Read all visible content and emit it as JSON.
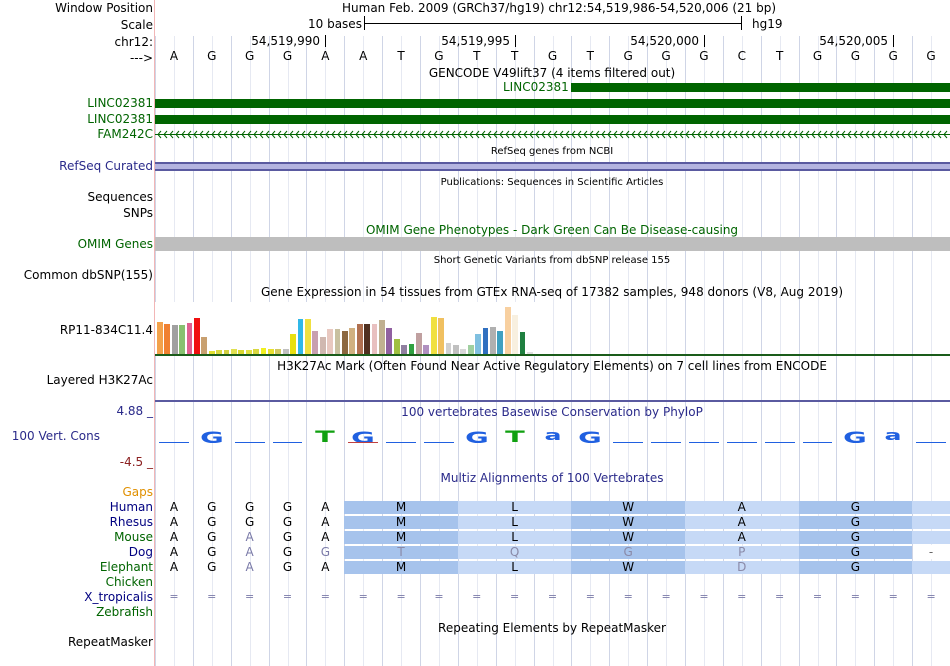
{
  "labels": {
    "window_position": "Window Position",
    "scale": "Scale",
    "chrom": "chr12:",
    "strand": "--->",
    "gene1": "LINC02381",
    "gene2": "LINC02381",
    "gene3": "FAM242C",
    "refseq": "RefSeq Curated",
    "sequences": "Sequences",
    "snps": "SNPs",
    "omim": "OMIM Genes",
    "dbsnp": "Common dbSNP(155)",
    "gtex_gene": "RP11-834C11.4",
    "h3k27ac": "Layered H3K27Ac",
    "cons_max": "4.88 _",
    "cons": "100 Vert. Cons",
    "cons_min": "-4.5 _",
    "gaps": "Gaps",
    "repeatmasker": "RepeatMasker"
  },
  "header": {
    "position": "Human Feb. 2009 (GRCh37/hg19)   chr12:54,519,986-54,520,006 (21 bp)",
    "scale_text": "10 bases",
    "assembly": "hg19",
    "ticks": [
      "54,519,990",
      "54,519,995",
      "54,520,000",
      "54,520,005"
    ]
  },
  "bases": [
    "A",
    "G",
    "G",
    "G",
    "A",
    "A",
    "T",
    "G",
    "T",
    "T",
    "G",
    "T",
    "G",
    "G",
    "G",
    "C",
    "T",
    "G",
    "G",
    "G",
    "G"
  ],
  "centers": {
    "gencode": "GENCODE V49lift37 (4 items filtered out)",
    "gencode_item": "LINC02381",
    "refseq": "RefSeq genes from NCBI",
    "publications": "Publications: Sequences in Scientific Articles",
    "omim": "OMIM Gene Phenotypes - Dark Green Can Be Disease-causing",
    "dbsnp": "Short Genetic Variants from dbSNP release 155",
    "gtex": "Gene Expression in 54 tissues from GTEx RNA-seq of 17382 samples, 948 donors (V8, Aug 2019)",
    "h3k27ac": "H3K27Ac Mark (Often Found Near Active Regulatory Elements) on 7 cell lines from ENCODE",
    "phylop": "100 vertebrates Basewise Conservation by PhyloP",
    "multiz": "Multiz Alignments of 100 Vertebrates",
    "repeatmasker": "Repeating Elements by RepeatMasker"
  },
  "gtex_values": [
    0.62,
    0.58,
    0.55,
    0.56,
    0.6,
    0.7,
    0.33,
    0.06,
    0.08,
    0.08,
    0.1,
    0.08,
    0.08,
    0.1,
    0.12,
    0.1,
    0.1,
    0.1,
    0.38,
    0.68,
    0.68,
    0.45,
    0.33,
    0.48,
    0.48,
    0.45,
    0.5,
    0.58,
    0.58,
    0.58,
    0.65,
    0.5,
    0.28,
    0.18,
    0.2,
    0.4,
    0.18,
    0.72,
    0.7,
    0.22,
    0.18,
    0.1,
    0.18,
    0.38,
    0.5,
    0.52,
    0.45,
    0.9,
    0.75,
    0.42,
    0.03
  ],
  "gtex_colors": [
    "#f3a14a",
    "#f08030",
    "#a0a0a0",
    "#88c070",
    "#e06090",
    "#f01010",
    "#c8a070",
    "#e0e030",
    "#d8d840",
    "#d0d040",
    "#e0e050",
    "#d8d830",
    "#e0e040",
    "#d8d840",
    "#f0f020",
    "#e8e030",
    "#d0c860",
    "#c0c0c0",
    "#e8e010",
    "#30b8e8",
    "#f0e040",
    "#c8a0b0",
    "#d0b8b0",
    "#e8c8c0",
    "#c8c0a0",
    "#8c6840",
    "#d0b080",
    "#b07050",
    "#503020",
    "#e8c0c0",
    "#c0b090",
    "#9060a0",
    "#a0c040",
    "#9080a0",
    "#30a040",
    "#c0a0a0",
    "#b090c0",
    "#f0e040",
    "#f0c060",
    "#d0d0d0",
    "#c0c0c0",
    "#d8d8d8",
    "#a0d0a0",
    "#80c0e0",
    "#3070c0",
    "#b0b0b0",
    "#40a0c0",
    "#f8d0a0",
    "#f8f0e0",
    "#208040",
    "#e0e0e0"
  ],
  "conservation": [
    "",
    "G",
    "",
    "",
    "T",
    "G",
    "",
    "",
    "G",
    "T",
    "a",
    "G",
    "",
    "",
    "",
    "",
    "",
    "",
    "G",
    "a",
    ""
  ],
  "multiz": {
    "species": [
      "Human",
      "Rhesus",
      "Mouse",
      "Dog",
      "Elephant",
      "Chicken",
      "X_tropicalis",
      "Zebrafish"
    ],
    "colors": [
      "#000080",
      "#000080",
      "#006400",
      "#000080",
      "#006400",
      "#006400",
      "#000080",
      "#006400"
    ],
    "bases": [
      [
        "A",
        "G",
        "G",
        "G",
        "A"
      ],
      [
        "A",
        "G",
        "G",
        "G",
        "A"
      ],
      [
        "A",
        "G",
        "A",
        "G",
        "A"
      ],
      [
        "A",
        "G",
        "A",
        "G",
        "G"
      ],
      [
        "A",
        "G",
        "A",
        "G",
        "A"
      ]
    ],
    "aa": [
      [
        "M",
        "L",
        "W",
        "A",
        "G"
      ],
      [
        "M",
        "L",
        "W",
        "A",
        "G"
      ],
      [
        "M",
        "L",
        "W",
        "A",
        "G"
      ],
      [
        "T",
        "Q",
        "G",
        "P",
        "G"
      ],
      [
        "M",
        "L",
        "W",
        "D",
        "G"
      ]
    ],
    "dog_tail": "-",
    "xtrop": "="
  },
  "colors": {
    "gene": "#006400",
    "refseq_bar": "#9090cc",
    "omim_bar": "#bebebe",
    "blue_track": "#2a2a8a",
    "gaps": "#e09000",
    "cons_min": "#8b2020",
    "aa_dark": "#a6c3ec",
    "aa_light": "#c6d9f6"
  }
}
